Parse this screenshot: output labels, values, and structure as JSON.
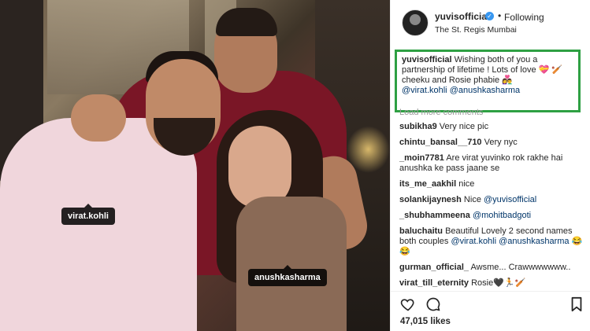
{
  "photo": {
    "tags": [
      {
        "label": "virat.kohli"
      },
      {
        "label": "anushkasharma"
      }
    ]
  },
  "post": {
    "username": "yuvisofficial",
    "verified_mark": "✓",
    "separator": "•",
    "follow_label": "Following",
    "location": "The St. Regis Mumbai",
    "caption": {
      "user": "yuvisofficial",
      "text": " Wishing both of you a partnership of lifetime ! Lots of love 💝 🏏 cheeku and Rosie phabie 👩‍❤️‍👨 ",
      "mention1": "@virat.kohli",
      "mention2": "@anushkasharma"
    },
    "load_more": "Load more comments",
    "comments": [
      {
        "user": "subikha9",
        "text": " Very nice pic"
      },
      {
        "user": "chintu_bansal__710",
        "text": " Very nyc"
      },
      {
        "user": "_moin7781",
        "text": " Are virat yuvinko rok rakhe hai anushka ke pass jaane se"
      },
      {
        "user": "its_me_aakhil",
        "text": " nice"
      },
      {
        "user": "solankijaynesh",
        "text": " Nice ",
        "mention": "@yuvisofficial"
      },
      {
        "user": "_shubhammeena",
        "text": " ",
        "mention": "@mohitbadgoti"
      },
      {
        "user": "baluchaitu",
        "text": " Beautiful Lovely 2 second names both couples ",
        "mention": "@virat.kohli @anushkasharma 😂😂"
      },
      {
        "user": "gurman_official_",
        "text": " Awsme... Crawwwwwww.."
      },
      {
        "user": "virat_till_eternity",
        "text": " Rosie🖤🏃🏏"
      }
    ],
    "likes": "47,015 likes"
  },
  "icons": {
    "heart": "heart-icon",
    "comment": "comment-icon",
    "bookmark": "bookmark-icon"
  }
}
